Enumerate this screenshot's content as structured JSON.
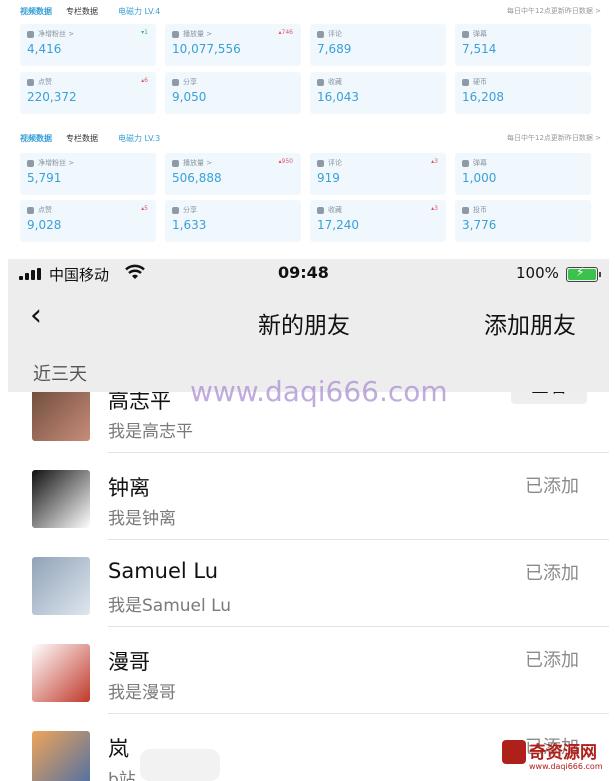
{
  "panels": [
    {
      "tabs": [
        "视频数据",
        "专栏数据",
        "电磁力 LV.4"
      ],
      "note": "每日中午12点更新昨日数据 >",
      "cards": [
        {
          "label": "净增粉丝 >",
          "value": "4,416",
          "delta": "▾1",
          "delta_color": "green"
        },
        {
          "label": "播放量 >",
          "value": "10,077,556",
          "delta": "▴746",
          "delta_color": "up"
        },
        {
          "label": "评论",
          "value": "7,689",
          "delta": ""
        },
        {
          "label": "弹幕",
          "value": "7,514",
          "delta": ""
        },
        {
          "label": "点赞",
          "value": "220,372",
          "delta": "▴6",
          "delta_color": "up"
        },
        {
          "label": "分享",
          "value": "9,050",
          "delta": ""
        },
        {
          "label": "收藏",
          "value": "16,043",
          "delta": ""
        },
        {
          "label": "硬币",
          "value": "16,208",
          "delta": ""
        }
      ]
    },
    {
      "tabs": [
        "视频数据",
        "专栏数据",
        "电磁力 LV.3"
      ],
      "note": "每日中午12点更新昨日数据 >",
      "cards": [
        {
          "label": "净增粉丝 >",
          "value": "5,791",
          "delta": ""
        },
        {
          "label": "播放量 >",
          "value": "506,888",
          "delta": "▴950",
          "delta_color": "up"
        },
        {
          "label": "评论",
          "value": "919",
          "delta": "▴3",
          "delta_color": "up"
        },
        {
          "label": "弹幕",
          "value": "1,000",
          "delta": ""
        },
        {
          "label": "点赞",
          "value": "9,028",
          "delta": "▴5",
          "delta_color": "up"
        },
        {
          "label": "分享",
          "value": "1,633",
          "delta": ""
        },
        {
          "label": "收藏",
          "value": "17,240",
          "delta": "▴3",
          "delta_color": "up"
        },
        {
          "label": "投币",
          "value": "3,776",
          "delta": ""
        }
      ]
    }
  ],
  "status_bar": {
    "carrier": "中国移动",
    "time": "09:48",
    "battery": "100%",
    "battery_level": 1.0
  },
  "nav": {
    "back": "‹",
    "title": "新的朋友",
    "action": "添加朋友"
  },
  "section": "近三天",
  "friends": [
    {
      "name": "高志平",
      "message": "我是高志平",
      "status": "",
      "button": "查看",
      "avatar_colors": [
        "#6b4a3a",
        "#c88c7a"
      ]
    },
    {
      "name": "钟离",
      "message": "我是钟离",
      "status": "已添加",
      "avatar_colors": [
        "#111111",
        "#ffffff"
      ]
    },
    {
      "name": "Samuel Lu",
      "message": "我是Samuel Lu",
      "status": "已添加",
      "avatar_colors": [
        "#8fa3b8",
        "#dfe6ee"
      ]
    },
    {
      "name": "漫哥",
      "message": "我是漫哥",
      "status": "已添加",
      "avatar_colors": [
        "#ffffff",
        "#c0392b"
      ]
    },
    {
      "name": "岚",
      "message": "b站 怎么收费",
      "status": "已添加",
      "avatar_colors": [
        "#f0a45a",
        "#4a6fa5"
      ]
    }
  ],
  "watermark": "www.daqi666.com",
  "logo": {
    "title": "奇资源网",
    "url": "www.daqi666.com"
  }
}
